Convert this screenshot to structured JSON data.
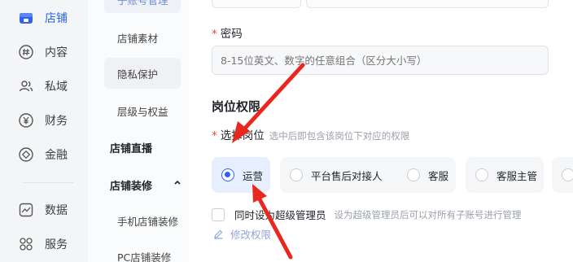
{
  "rail": {
    "items": [
      {
        "label": "店铺",
        "icon": "store-icon",
        "active": true
      },
      {
        "label": "内容",
        "icon": "hash-icon"
      },
      {
        "label": "私域",
        "icon": "users-icon"
      },
      {
        "label": "财务",
        "icon": "yen-icon"
      },
      {
        "label": "金融",
        "icon": "finance-icon"
      },
      {
        "label": "数据",
        "icon": "chart-icon"
      },
      {
        "label": "服务",
        "icon": "grid-icon"
      }
    ]
  },
  "submenu": {
    "top_partial": "子账号管理",
    "items": [
      "店铺素材",
      "隐私保护",
      "层级与权益"
    ],
    "group_live": "店铺直播",
    "group_decor": "店铺装修",
    "decor_items": [
      "手机店铺装修",
      "PC店铺装修"
    ]
  },
  "form": {
    "password_label": "密码",
    "password_placeholder": "8-15位英文、数字的任意组合（区分大小写）",
    "section_title": "岗位权限",
    "position_label": "选择岗位",
    "position_hint": "选中后即包含该岗位下对应的权限",
    "positions": [
      "运营",
      "平台售后对接人",
      "客服",
      "客服主管"
    ],
    "selected_position": "运营",
    "admin_label": "同时设为超级管理员",
    "admin_desc": "设为超级管理员后可以对所有子账号进行管理",
    "edit_link": "修改权限"
  },
  "colors": {
    "accent": "#2d63f0",
    "required": "#e84a3a",
    "arrow": "#e8271e"
  }
}
